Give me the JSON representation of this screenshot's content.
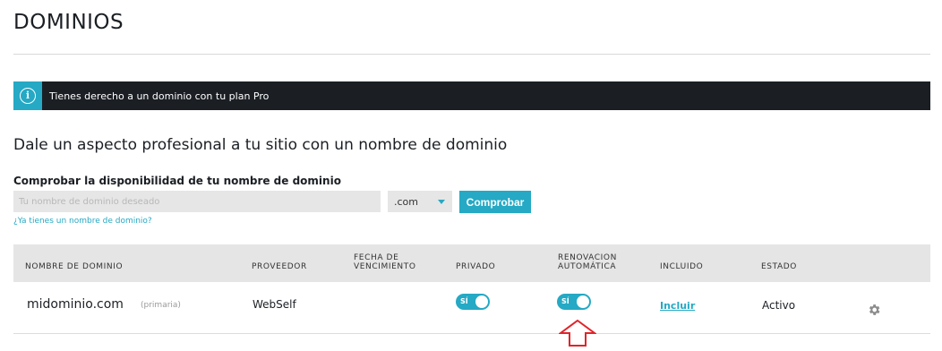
{
  "page": {
    "title": "DOMINIOS"
  },
  "banner": {
    "icon": "info-icon",
    "icon_glyph": "i",
    "text": "Tienes derecho a un dominio con tu plan Pro"
  },
  "headline": "Dale un aspecto profesional a tu sitio con un nombre de dominio",
  "search": {
    "label": "Comprobar la disponibilidad de tu nombre de dominio",
    "placeholder": "Tu nombre de dominio deseado",
    "tld": ".com",
    "button": "Comprobar",
    "own_domain_link": "¿Ya tienes un nombre de dominio?"
  },
  "table": {
    "headers": {
      "name": "NOMBRE DE DOMINIO",
      "provider": "PROVEEDOR",
      "expiry_line1": "FECHA DE",
      "expiry_line2": "VENCIMIENTO",
      "private": "PRIVADO",
      "renewal_line1": "RENOVACION",
      "renewal_line2": "AUTOMÁTICA",
      "included": "INCLUIDO",
      "status": "ESTADO"
    },
    "row": {
      "domain": "midominio.com",
      "primary_tag": "(primaria)",
      "provider": "WebSelf",
      "expiry": "",
      "private_toggle": "SÍ",
      "renewal_toggle": "SÍ",
      "included_link": "Incluir",
      "status": "Activo"
    }
  },
  "colors": {
    "accent": "#25a9c4",
    "banner_bg": "#1b1f24",
    "arrow": "#e0242a"
  }
}
